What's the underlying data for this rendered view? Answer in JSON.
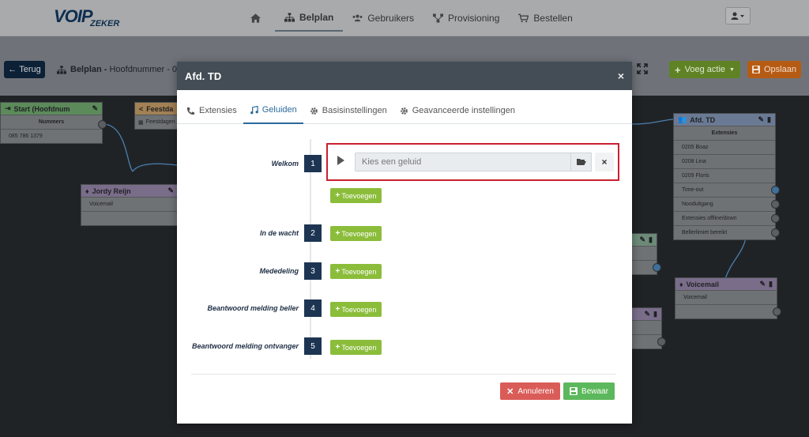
{
  "logo": {
    "main": "VOIP",
    "sub": "ZEKER"
  },
  "nav": {
    "items": [
      {
        "label": ""
      },
      {
        "label": "Belplan"
      },
      {
        "label": "Gebruikers"
      },
      {
        "label": "Provisioning"
      },
      {
        "label": "Bestellen"
      }
    ]
  },
  "toolbar": {
    "back_label": "Terug",
    "crumb_bold": "Belplan -",
    "crumb_rest": "Hoofdnummer - 085",
    "add_action_label": "Voeg actie",
    "save_label": "Opslaan"
  },
  "canvas": {
    "start_node": {
      "title": "Start (Hoofdnum",
      "rows": [
        "Nummers",
        "085 786 1379"
      ]
    },
    "feest_node": {
      "title": "Feestda",
      "rows": [
        "Feestdagen"
      ]
    },
    "jordy_node": {
      "title": "Jordy Reijn",
      "rows": [
        "Voicemail",
        ""
      ]
    },
    "td_node": {
      "title": "Afd. TD",
      "rows": [
        "Extensies",
        "0205 Boaz",
        "0208 Lina",
        "0209 Floris",
        "Time-out",
        "Nooduitgang",
        "Extensies offline/down",
        "Bellerlimiet bereikt"
      ]
    },
    "voicemail_node": {
      "title": "Voicemail",
      "rows": [
        "Voicemail",
        ""
      ]
    }
  },
  "modal": {
    "title": "Afd. TD",
    "close": "×",
    "tabs": [
      {
        "label": "Extensies"
      },
      {
        "label": "Geluiden"
      },
      {
        "label": "Basisinstellingen"
      },
      {
        "label": "Geavanceerde instellingen"
      }
    ],
    "steps": [
      {
        "label": "Welkom",
        "num": "1"
      },
      {
        "label": "In de wacht",
        "num": "2"
      },
      {
        "label": "Mededeling",
        "num": "3"
      },
      {
        "label": "Beantwoord melding beller",
        "num": "4"
      },
      {
        "label": "Beantwoord melding ontvanger",
        "num": "5"
      }
    ],
    "sound_placeholder": "Kies een geluid",
    "add_label": "Toevoegen",
    "cancel_label": "Annuleren",
    "save_label": "Bewaar"
  }
}
